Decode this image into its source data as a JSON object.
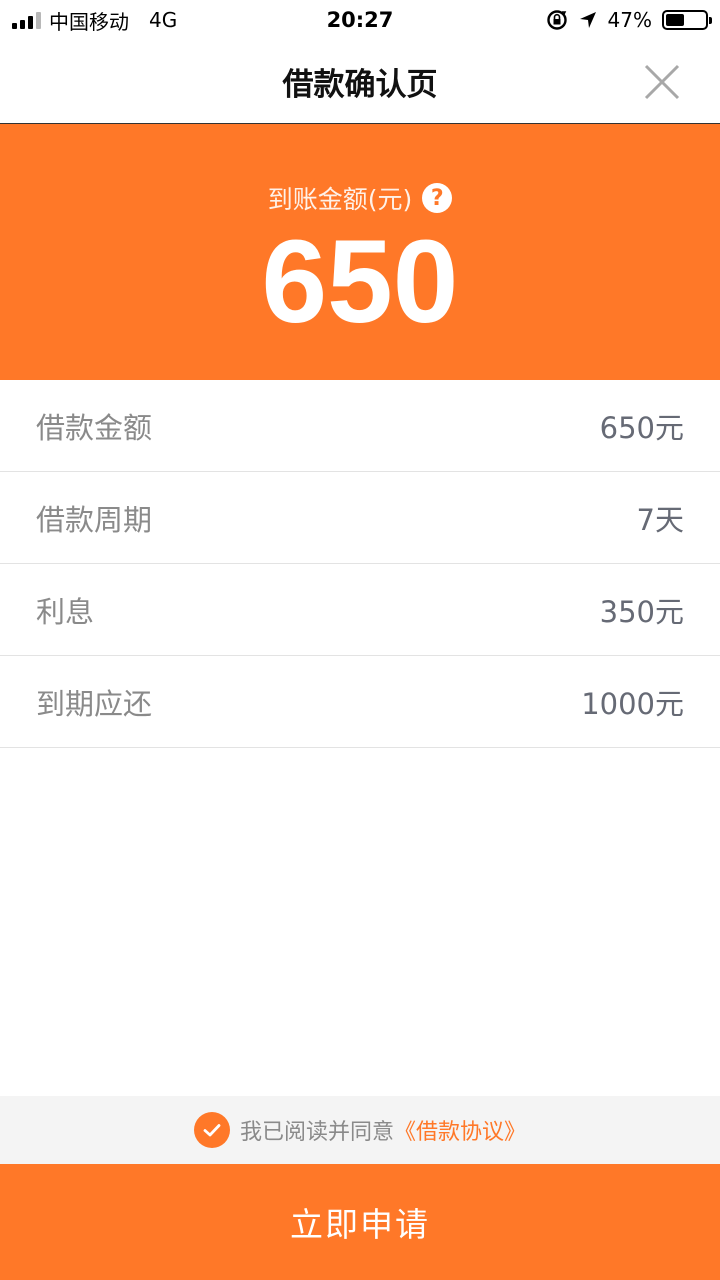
{
  "status_bar": {
    "carrier": "中国移动",
    "network": "4G",
    "time": "20:27",
    "battery": "47%",
    "battery_level": 0.47
  },
  "nav": {
    "title": "借款确认页"
  },
  "hero": {
    "label": "到账金额(元)",
    "help_symbol": "?",
    "amount": "650"
  },
  "rows": [
    {
      "label": "借款金额",
      "value": "650元"
    },
    {
      "label": "借款周期",
      "value": "7天"
    },
    {
      "label": "利息",
      "value": "350元"
    },
    {
      "label": "到期应还",
      "value": "1000元"
    }
  ],
  "agreement": {
    "text": "我已阅读并同意",
    "link": "《借款协议》",
    "checked": true
  },
  "submit": {
    "label": "立即申请"
  },
  "colors": {
    "accent": "#ff7828"
  }
}
